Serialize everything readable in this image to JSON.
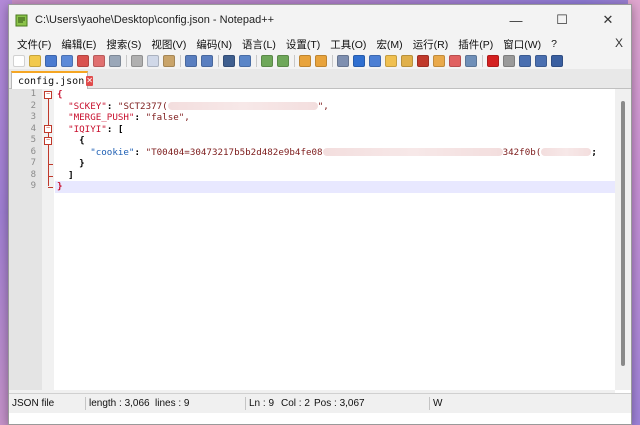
{
  "window": {
    "title": "C:\\Users\\yaohe\\Desktop\\config.json - Notepad++",
    "minimize_glyph": "—",
    "maximize_glyph": "☐",
    "close_glyph": "✕"
  },
  "menu": {
    "items": [
      "文件(F)",
      "编辑(E)",
      "搜索(S)",
      "视图(V)",
      "编码(N)",
      "语言(L)",
      "设置(T)",
      "工具(O)",
      "宏(M)",
      "运行(R)",
      "插件(P)",
      "窗口(W)",
      "?"
    ],
    "close_glyph": "X"
  },
  "toolbar": {
    "icons": [
      "new-file-icon",
      "open-file-icon",
      "save-icon",
      "save-all-icon",
      "close-icon",
      "close-all-icon",
      "print-icon",
      "cut-icon",
      "copy-icon",
      "paste-icon",
      "undo-icon",
      "redo-icon",
      "find-icon",
      "replace-icon",
      "zoom-in-icon",
      "zoom-out-icon",
      "sync-vertical-icon",
      "sync-horizontal-icon",
      "word-wrap-icon",
      "show-all-chars-icon",
      "indent-guide-icon",
      "user-lang-icon",
      "doc-map-icon",
      "function-list-icon",
      "folder-workspace-icon",
      "monitoring-icon",
      "record-macro-icon",
      "stop-record-icon",
      "play-macro-icon",
      "play-multiple-icon",
      "save-macro-icon"
    ]
  },
  "tab": {
    "label": "config.json",
    "close_glyph": "✕"
  },
  "editor": {
    "line_numbers": [
      "1",
      "2",
      "3",
      "4",
      "5",
      "6",
      "7",
      "8",
      "9"
    ],
    "lines": {
      "l1": "{",
      "l2_key": "\"SCKEY\"",
      "l2_colon": ":",
      "l2_val_start": "\"SCT2377(",
      "l2_val_end": "\",",
      "l3_key": "\"MERGE_PUSH\"",
      "l3_colon": ":",
      "l3_val": "\"false\",",
      "l4_key": "\"IQIYI\"",
      "l4_colon": ":",
      "l4_bracket": "[",
      "l5": "{",
      "l6_key": "\"cookie\"",
      "l6_colon": ":",
      "l6_val_start": "\"T00404=30473217b5b2d482e9b4fe08",
      "l6_val_mid": "342f0b(",
      "l6_val_end": ";",
      "l7": "}",
      "l8": "]",
      "l9": "}"
    }
  },
  "status": {
    "file_type": "JSON file",
    "length": "length : 3,066",
    "lines": "lines : 9",
    "ln": "Ln : 9",
    "col": "Col : 2",
    "pos": "Pos : 3,067",
    "eol": "W"
  },
  "colors": {
    "key": "#c8102e",
    "nested_key": "#1e5fb4",
    "string": "#7d1c1c",
    "current_line": "#e8e8ff",
    "tab_accent": "#f5a623"
  }
}
